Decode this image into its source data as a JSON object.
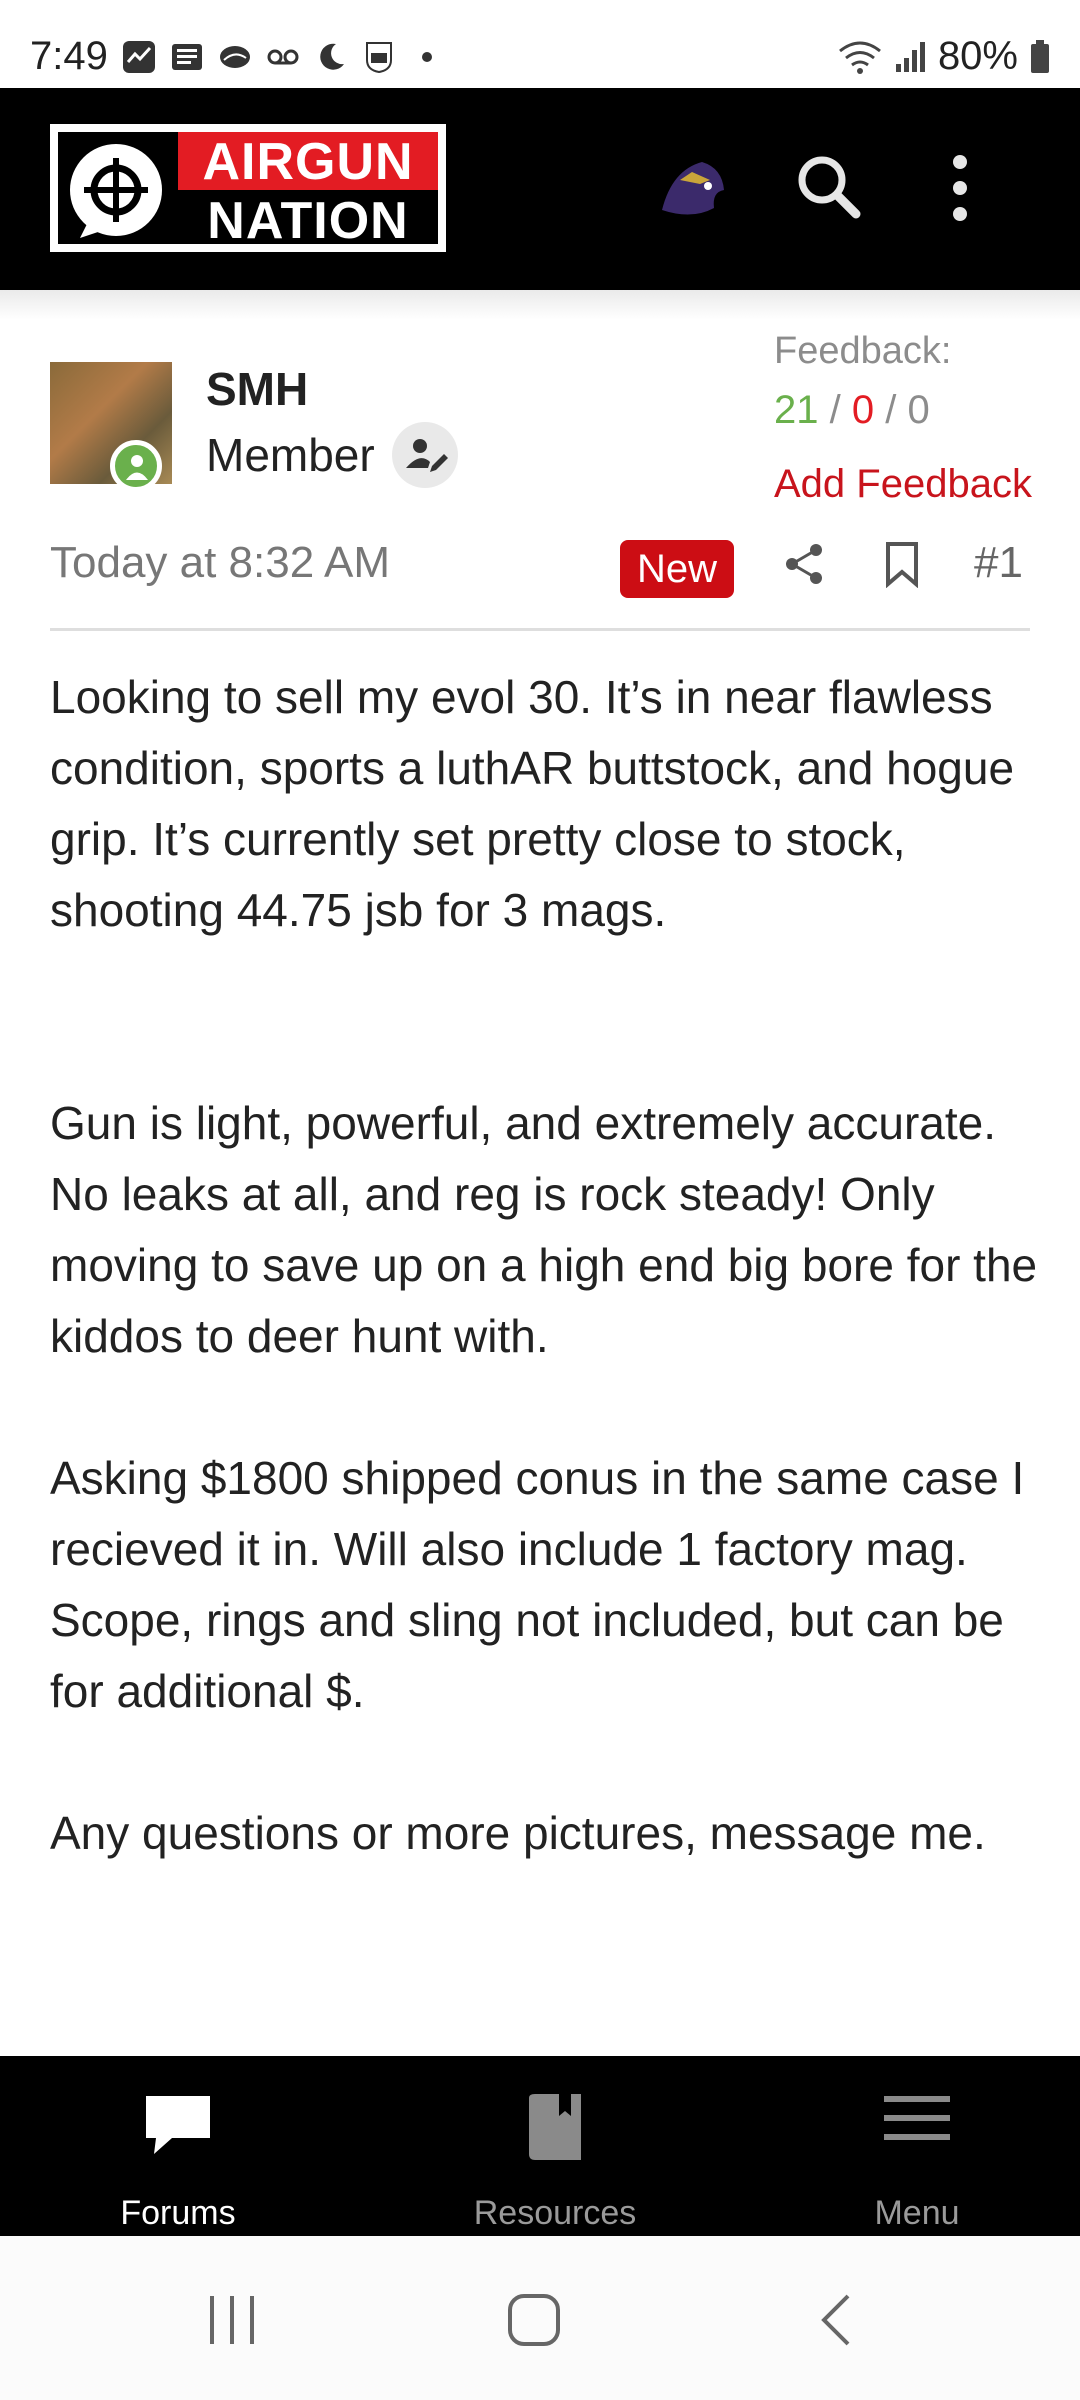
{
  "status_bar": {
    "time": "7:49",
    "battery": "80%"
  },
  "header": {
    "logo_top": "AIRGUN",
    "logo_bottom": "NATION",
    "icons": [
      "crosshair-logo-icon",
      "team-avatar-icon",
      "search-icon",
      "more-vertical-icon"
    ]
  },
  "post": {
    "username": "SMH",
    "role": "Member",
    "feedback_label": "Feedback:",
    "feedback_positive": "21",
    "feedback_negative": "0",
    "feedback_neutral": "0",
    "feedback_sep": "/",
    "add_feedback": "Add Feedback",
    "timestamp": "Today at 8:32 AM",
    "badge": "New",
    "post_number": "#1",
    "paragraphs": [
      "Looking to sell my evol 30. It’s in near flawless condition, sports a luthAR buttstock, and hogue grip. It’s currently set pretty close to stock, shooting 44.75 jsb for 3 mags.",
      "Gun is light, powerful, and extremely accurate. No leaks at all, and reg is rock steady! Only moving to save up on a high end big bore for the kiddos to deer hunt with.",
      "Asking $1800 shipped conus in the same case I recieved it in. Will also include 1 factory mag. Scope, rings and sling not included, but can be for additional $.",
      "Any questions or more pictures, message me."
    ]
  },
  "bottom_nav": {
    "forums": "Forums",
    "resources": "Resources",
    "menu": "Menu"
  },
  "colors": {
    "brand_red": "#e31c23",
    "positive": "#6ab04c",
    "header_bg": "#000000"
  }
}
